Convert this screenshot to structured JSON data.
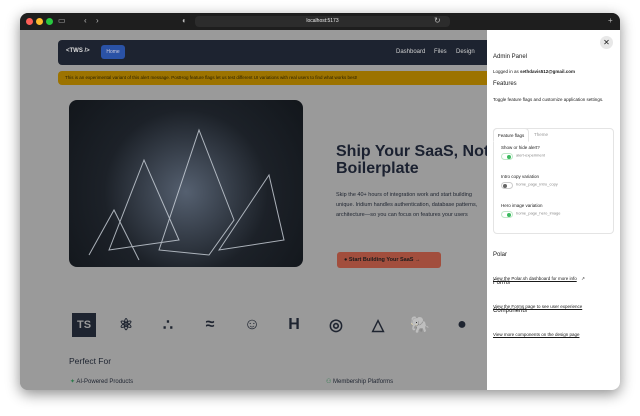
{
  "browser": {
    "url": "localhost:5173"
  },
  "nav": {
    "logo": "<TWS />",
    "home": "Home",
    "links": [
      "Dashboard",
      "Files",
      "Design"
    ]
  },
  "alert": "This is an experimental variant of this alert message. PostHog feature flags let us test different UI variations with real users to find what works best!",
  "hero": {
    "title_line1": "Ship Your SaaS, Not",
    "title_line2": "Boilerplate",
    "sub": [
      "Skip the 40+ hours of integration work and start building",
      "unique. Iridium handles authentication, database patterns,",
      "architecture—so you can focus on features your users"
    ],
    "cta": "Start Building Your SaaS"
  },
  "logos": [
    "TS",
    "⚛",
    "∴",
    "≈",
    "☺",
    "H",
    "◎",
    "△",
    "🐘",
    "●"
  ],
  "perfect_for": {
    "title": "Perfect For",
    "items": [
      "AI-Powered Products",
      "Membership Platforms"
    ]
  },
  "panel": {
    "title": "Admin Panel",
    "logged_in_prefix": "Logged in as ",
    "email": "sethdavis512@gmail.com",
    "features_title": "Features",
    "features_desc": "Toggle feature flags and customize application settings.",
    "tabs": [
      "Feature flags",
      "Theme"
    ],
    "flags": [
      {
        "label": "Show or hide alert?",
        "key": "alert-experiment",
        "on": true
      },
      {
        "label": "Intro copy variation",
        "key": "home_page_intro_copy",
        "on": false
      },
      {
        "label": "Hero image variation",
        "key": "home_page_hero_image",
        "on": true
      }
    ],
    "polar_title": "Polar",
    "polar_link": "View the Polar.sh dashboard for more info",
    "forms_title": "Forms",
    "forms_link": "View the Forms page to see user experience",
    "components_title": "Components",
    "components_link": "View more components on the design page"
  }
}
